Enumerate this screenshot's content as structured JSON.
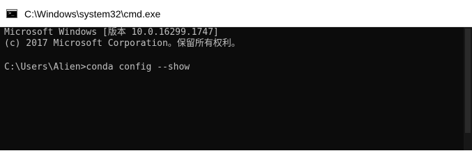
{
  "window": {
    "title": "C:\\Windows\\system32\\cmd.exe",
    "icon": "cmd-prompt-icon"
  },
  "console": {
    "lines": [
      "Microsoft Windows [版本 10.0.16299.1747]",
      "(c) 2017 Microsoft Corporation。保留所有权利。",
      "",
      "C:\\Users\\Alien>conda config --show"
    ],
    "text_color": "#c0c0c0",
    "background": "#0c0c0c"
  }
}
